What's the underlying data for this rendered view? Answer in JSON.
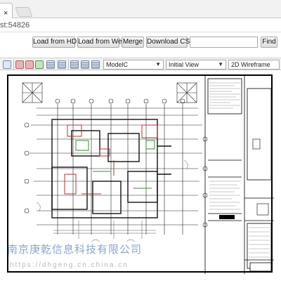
{
  "browser": {
    "tab_close_glyph": "×",
    "address_fragment": "st:54826"
  },
  "loader": {
    "buttons": [
      {
        "id": "load-hdd",
        "label": "Load from HDD"
      },
      {
        "id": "load-web",
        "label": "Load from Web"
      },
      {
        "id": "merge",
        "label": "Merge"
      },
      {
        "id": "download-csv",
        "label": "Download CSV"
      },
      {
        "id": "find",
        "label": "Find"
      }
    ],
    "search": {
      "value": "",
      "placeholder": ""
    }
  },
  "toolbar": {
    "icons": [
      "zoom-extents-icon",
      "stop-icon",
      "render-icon",
      "layers-icon",
      "properties-icon",
      "align-left-icon",
      "align-center-icon",
      "align-right-icon"
    ],
    "space_select": {
      "value": "ModelC"
    },
    "view_select": {
      "value": "Initial View"
    },
    "visual_style_select": {
      "value": "2D Wireframe"
    }
  },
  "drawing": {
    "content": "architectural floor plan sheet with title block"
  },
  "watermark": {
    "text": "南京庚乾信息科技有限公司",
    "url": "https://dhgeng.cn.china.cn"
  },
  "colors": {
    "accent": "#2a5aa8",
    "plan_red": "#b8322a",
    "plan_green": "#3a8a3a"
  }
}
